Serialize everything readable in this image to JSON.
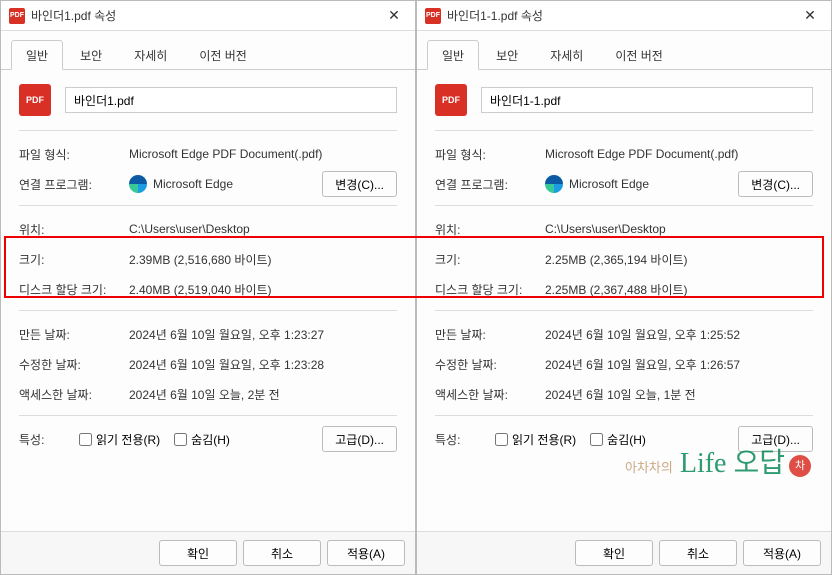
{
  "dialogs": [
    {
      "title": "바인더1.pdf 속성",
      "filename": "바인더1.pdf",
      "filetype_label": "파일 형식:",
      "filetype": "Microsoft Edge PDF Document(.pdf)",
      "openwith_label": "연결 프로그램:",
      "openwith": "Microsoft Edge",
      "change_btn": "변경(C)...",
      "location_label": "위치:",
      "location": "C:\\Users\\user\\Desktop",
      "size_label": "크기:",
      "size": "2.39MB (2,516,680 바이트)",
      "disksize_label": "디스크 할당 크기:",
      "disksize": "2.40MB (2,519,040 바이트)",
      "created_label": "만든 날짜:",
      "created": "2024년 6월 10일 월요일, 오후 1:23:27",
      "modified_label": "수정한 날짜:",
      "modified": "2024년 6월 10일 월요일, 오후 1:23:28",
      "accessed_label": "액세스한 날짜:",
      "accessed": "2024년 6월 10일 오늘, 2분 전",
      "attr_label": "특성:",
      "readonly_label": "읽기 전용(R)",
      "hidden_label": "숨김(H)",
      "advanced_btn": "고급(D)..."
    },
    {
      "title": "바인더1-1.pdf 속성",
      "filename": "바인더1-1.pdf",
      "filetype_label": "파일 형식:",
      "filetype": "Microsoft Edge PDF Document(.pdf)",
      "openwith_label": "연결 프로그램:",
      "openwith": "Microsoft Edge",
      "change_btn": "변경(C)...",
      "location_label": "위치:",
      "location": "C:\\Users\\user\\Desktop",
      "size_label": "크기:",
      "size": "2.25MB (2,365,194 바이트)",
      "disksize_label": "디스크 할당 크기:",
      "disksize": "2.25MB (2,367,488 바이트)",
      "created_label": "만든 날짜:",
      "created": "2024년 6월 10일 월요일, 오후 1:25:52",
      "modified_label": "수정한 날짜:",
      "modified": "2024년 6월 10일 월요일, 오후 1:26:57",
      "accessed_label": "액세스한 날짜:",
      "accessed": "2024년 6월 10일 오늘, 1분 전",
      "attr_label": "특성:",
      "readonly_label": "읽기 전용(R)",
      "hidden_label": "숨김(H)",
      "advanced_btn": "고급(D)..."
    }
  ],
  "tabs": [
    "일반",
    "보안",
    "자세히",
    "이전 버전"
  ],
  "footer": {
    "ok": "확인",
    "cancel": "취소",
    "apply": "적용(A)"
  },
  "watermark": {
    "sub": "아차차의",
    "main": "Life 오답",
    "stamp": "차"
  }
}
